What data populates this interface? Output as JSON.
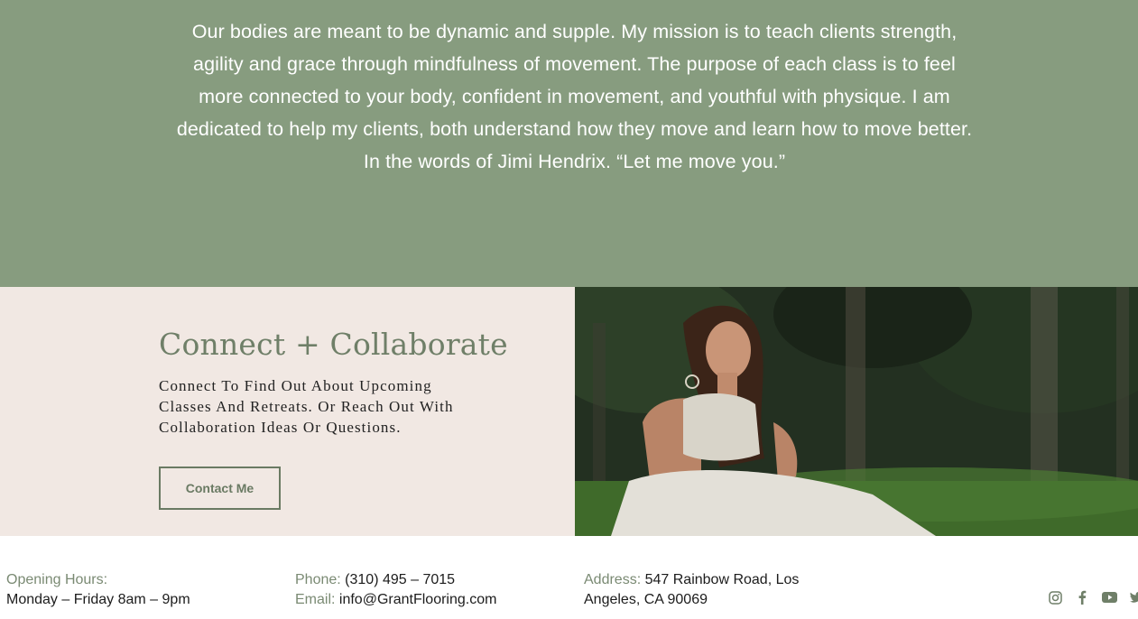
{
  "mission": {
    "text": "Our bodies are meant to be dynamic and supple. My mission is to teach clients strength, agility and grace through mindfulness of movement. The purpose of each class is to feel more connected to your body, confident in movement, and youthful with physique. I am dedicated to help my clients, both understand how they move and learn how to move better. In the words of Jimi Hendrix. “Let me move you.”"
  },
  "connect": {
    "heading": "Connect + Collaborate",
    "subtext": "Connect To Find Out About Upcoming Classes And Retreats. Or Reach Out With Collaboration Ideas Or Questions.",
    "button_label": "Contact Me"
  },
  "footer": {
    "hours_label": "Opening Hours:",
    "hours_value": "Monday – Friday 8am – 9pm",
    "phone_label": "Phone:",
    "phone_value": "(310) 495 – 7015",
    "email_label": "Email:",
    "email_value": "info@GrantFlooring.com",
    "address_label": "Address:",
    "address_line1": "547 Rainbow Road, Los",
    "address_line2": "Angeles, CA 90069"
  },
  "social_icons": [
    "instagram-icon",
    "facebook-icon",
    "youtube-icon",
    "twitter-icon"
  ],
  "colors": {
    "sage": "#879c7f",
    "blush": "#f1e8e3",
    "accent_text": "#6f7f68"
  }
}
